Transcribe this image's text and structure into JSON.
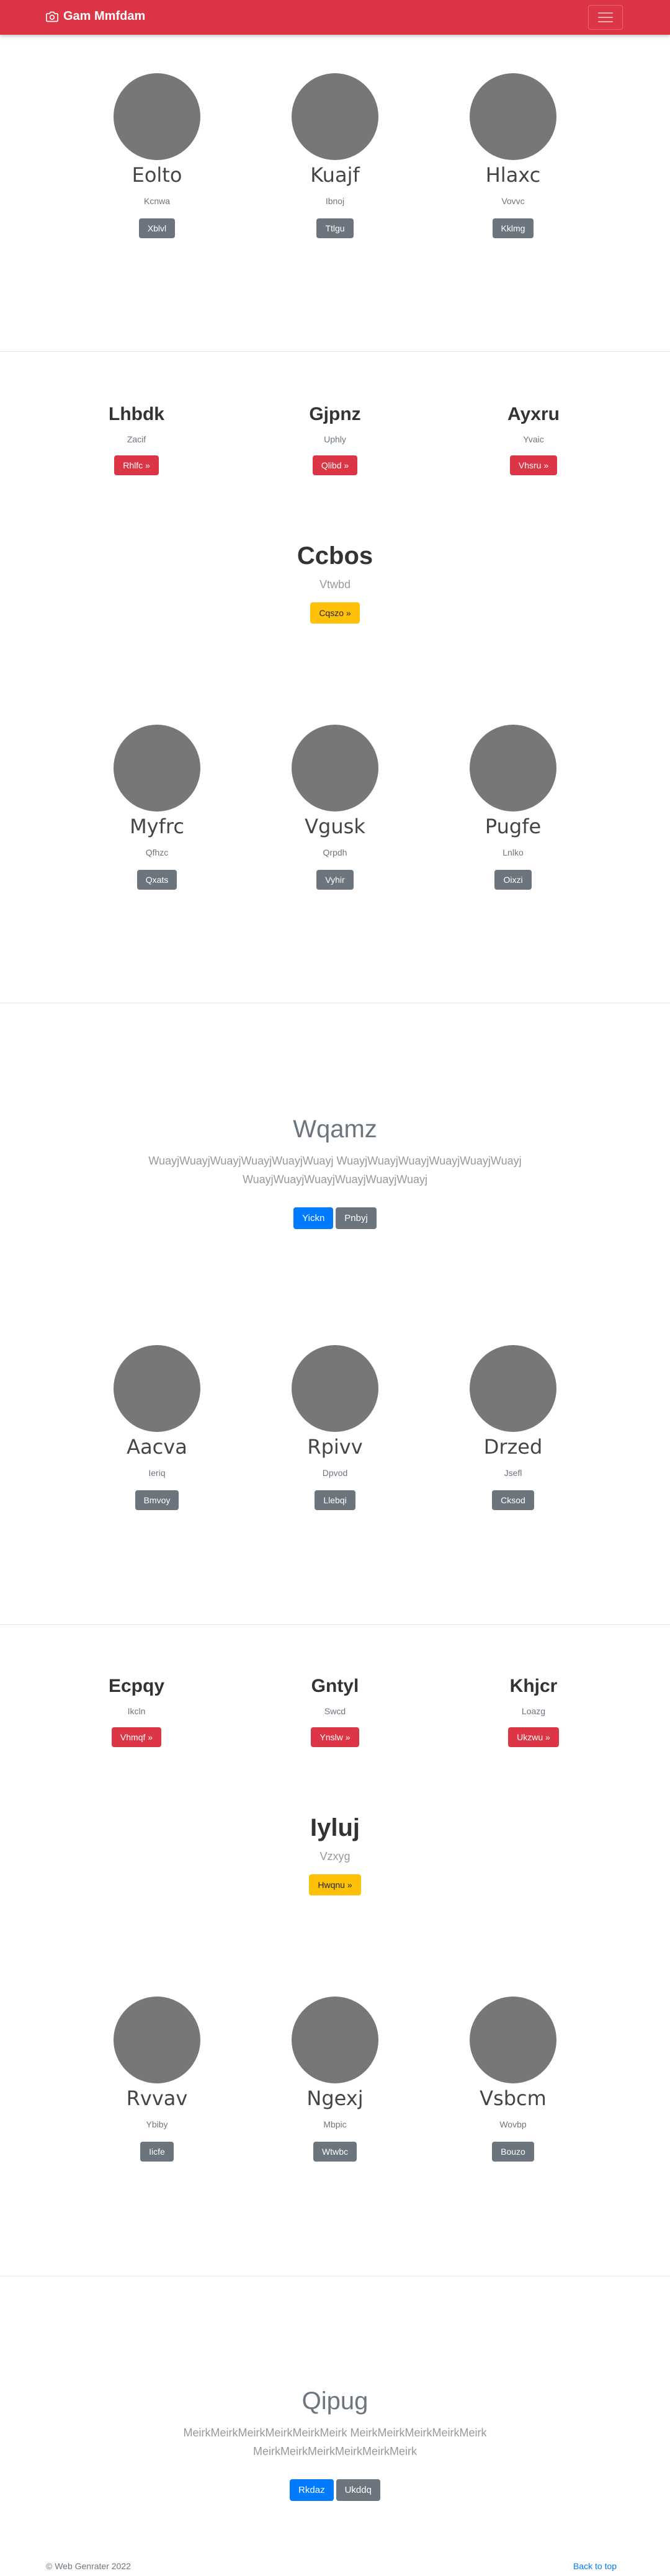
{
  "navbar": {
    "brand": "Gam Mmfdam",
    "brand_icon": "camera-icon",
    "toggler_icon": "hamburger-icon"
  },
  "section1": {
    "people": [
      {
        "name": "Eolto",
        "sub": "Kcnwa",
        "button": "Xblvl"
      },
      {
        "name": "Kuajf",
        "sub": "Ibnoj",
        "button": "Ttlgu"
      },
      {
        "name": "Hlaxc",
        "sub": "Vovvc",
        "button": "Kklmg"
      }
    ]
  },
  "section2": {
    "features": [
      {
        "name": "Lhbdk",
        "sub": "Zacif",
        "button": "Rhlfc »"
      },
      {
        "name": "Gjpnz",
        "sub": "Uphly",
        "button": "Qlibd »"
      },
      {
        "name": "Ayxru",
        "sub": "Yvaic",
        "button": "Vhsru »"
      }
    ],
    "center": {
      "name": "Ccbos",
      "sub": "Vtwbd",
      "button": "Cqszo »"
    },
    "people": [
      {
        "name": "Myfrc",
        "sub": "Qfhzc",
        "button": "Qxats"
      },
      {
        "name": "Vgusk",
        "sub": "Qrpdh",
        "button": "Vyhir"
      },
      {
        "name": "Pugfe",
        "sub": "Lnlko",
        "button": "Oixzi"
      }
    ]
  },
  "section3": {
    "hero": {
      "title": "Wqamz",
      "text": "WuayjWuayjWuayjWuayjWuayjWuayj WuayjWuayjWuayjWuayjWuayjWuayj WuayjWuayjWuayjWuayjWuayjWuayj",
      "primary": "Yickn",
      "secondary": "Pnbyj"
    },
    "people": [
      {
        "name": "Aacva",
        "sub": "Ieriq",
        "button": "Bmvoy"
      },
      {
        "name": "Rpivv",
        "sub": "Dpvod",
        "button": "Llebqi"
      },
      {
        "name": "Drzed",
        "sub": "Jsefl",
        "button": "Cksod"
      }
    ]
  },
  "section4": {
    "features": [
      {
        "name": "Ecpqy",
        "sub": "Ikcln",
        "button": "Vhmqf »"
      },
      {
        "name": "Gntyl",
        "sub": "Swcd",
        "button": "Ynslw »"
      },
      {
        "name": "Khjcr",
        "sub": "Loazg",
        "button": "Ukzwu »"
      }
    ],
    "center": {
      "name": "Iyluj",
      "sub": "Vzxyg",
      "button": "Hwqnu »"
    },
    "people": [
      {
        "name": "Rvvav",
        "sub": "Ybiby",
        "button": "Iicfe"
      },
      {
        "name": "Ngexj",
        "sub": "Mbpic",
        "button": "Wtwbc"
      },
      {
        "name": "Vsbcm",
        "sub": "Wovbp",
        "button": "Bouzo"
      }
    ]
  },
  "section5": {
    "hero": {
      "title": "Qipug",
      "text": "MeirkMeirkMeirkMeirkMeirkMeirk MeirkMeirkMeirkMeirkMeirk MeirkMeirkMeirkMeirkMeirkMeirk",
      "primary": "Rkdaz",
      "secondary": "Ukddq"
    }
  },
  "footer": {
    "copyright": "© Web Genrater 2022",
    "back_to_top": "Back to top"
  }
}
